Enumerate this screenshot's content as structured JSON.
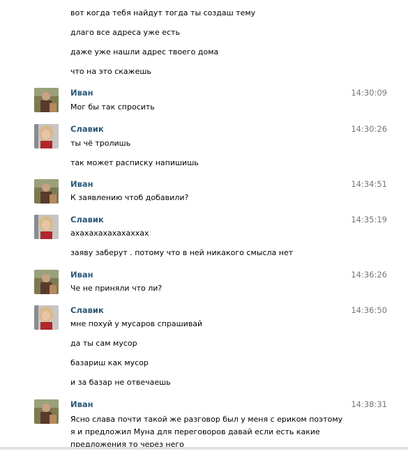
{
  "messages": [
    {
      "id": "m0",
      "lines": [
        "вот когда тебя найдут тогда ты создаш тему",
        "длаго все адреса уже есть",
        "даже уже нашли адрес твоего дома",
        "что на это скажешь"
      ]
    },
    {
      "id": "m1",
      "author": "Иван",
      "time": "14:30:09",
      "avatar": "ivan",
      "lines": [
        "Мог бы так спросить"
      ]
    },
    {
      "id": "m2",
      "author": "Славик",
      "time": "14:30:26",
      "avatar": "slavik",
      "lines": [
        "ты чё тролишь",
        "так может расписку напишишь"
      ]
    },
    {
      "id": "m3",
      "author": "Иван",
      "time": "14:34:51",
      "avatar": "ivan",
      "lines": [
        "К заявлению чтоб добавили?"
      ]
    },
    {
      "id": "m4",
      "author": "Славик",
      "time": "14:35:19",
      "avatar": "slavik",
      "lines": [
        "ахахахахахахаххах",
        "заяву заберут . потому что в ней никакого смысла нет"
      ]
    },
    {
      "id": "m5",
      "author": "Иван",
      "time": "14:36:26",
      "avatar": "ivan",
      "lines": [
        "Че не приняли что ли?"
      ]
    },
    {
      "id": "m6",
      "author": "Славик",
      "time": "14:36:50",
      "avatar": "slavik",
      "lines": [
        "мне похуй у мусаров спрашивай",
        "да ты сам мусор",
        "базариш как мусор",
        "и за базар не отвечаешь"
      ]
    },
    {
      "id": "m7",
      "author": "Иван",
      "time": "14:38:31",
      "avatar": "ivan",
      "lines": [
        "Ясно слава почти такой же разговор был у меня с ериком поэтому я и предложил Муна для переговоров давай если есть какие предложения то через него"
      ]
    }
  ],
  "colors": {
    "author": "#2b587a",
    "time": "#777777",
    "text": "#000000"
  },
  "icons": {
    "ivan": "user-photo-icon",
    "slavik": "user-photo-icon"
  }
}
